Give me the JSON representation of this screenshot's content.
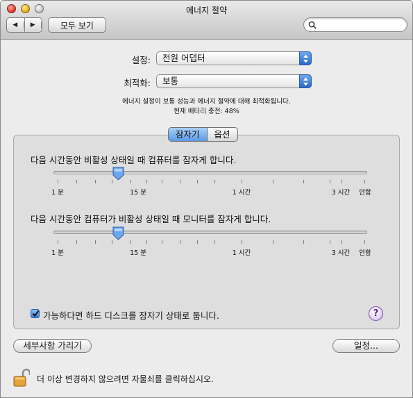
{
  "window": {
    "title": "에너지 절약"
  },
  "toolbar": {
    "back_icon": "◀",
    "forward_icon": "▶",
    "show_all_label": "모두 보기",
    "search_placeholder": ""
  },
  "settings": {
    "settings_label": "설정:",
    "settings_value": "전원 어댑터",
    "optimize_label": "최적화:",
    "optimize_value": "보통",
    "description": "에너지 설정이 보통 성능과 에너지 절약에 대해 최적화됩니다.",
    "battery_status": "현재 배터리 충전: 48%"
  },
  "tabs": [
    {
      "label": "잠자기",
      "active": true
    },
    {
      "label": "옵션",
      "active": false
    }
  ],
  "sleep": {
    "computer_title": "다음 시간동안 비활성 상태일 때 컴퓨터를 잠자게 합니다.",
    "computer_value_min": 15,
    "display_title": "다음 시간동안 컴퓨터가 비활성 상태일 때 모니터를 잠자게 합니다.",
    "display_value_min": 15,
    "tick_labels": [
      "1 분",
      "15 분",
      "1 시간",
      "3 시간",
      "안함"
    ],
    "disk_checkbox_label": "가능하다면 하드 디스크를 잠자기 상태로 둡니다.",
    "disk_checked": true,
    "help_label": "?"
  },
  "footer": {
    "hide_details_label": "세부사항 가리기",
    "schedule_label": "일정...",
    "lock_message": "더 이상 변경하지 않으려면 자물쇠를 클릭하십시오."
  },
  "colors": {
    "accent": "#3d7ad8",
    "help": "#7b4fae"
  }
}
